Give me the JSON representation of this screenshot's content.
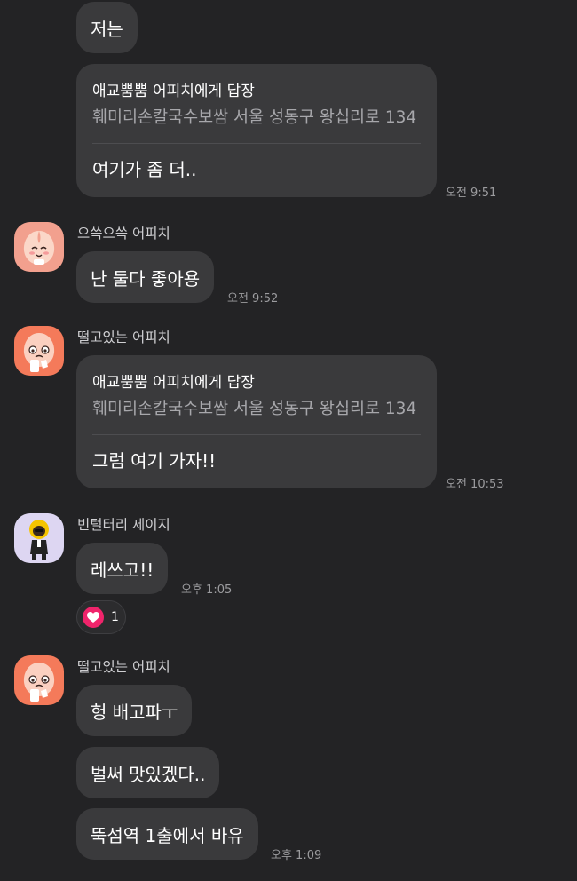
{
  "messages": {
    "m1": {
      "text": "저는"
    },
    "m2": {
      "reply_to": "애교뿜뿜 어피치에게 답장",
      "quote": "훼미리손칼국수보쌈 서울 성동구 왕십리로 134",
      "text": "여기가 좀 더..",
      "time": "오전 9:51"
    },
    "m3": {
      "sender": "으쓱으쓱 어피치",
      "text": "난 둘다 좋아용",
      "time": "오전 9:52"
    },
    "m4": {
      "sender": "떨고있는 어피치",
      "reply_to": "애교뿜뿜 어피치에게 답장",
      "quote": "훼미리손칼국수보쌈 서울 성동구 왕십리로 134",
      "text": "그럼 여기 가자!!",
      "time": "오전 10:53"
    },
    "m5": {
      "sender": "빈털터리 제이지",
      "text": "레쓰고!!",
      "time": "오후 1:05",
      "reaction_count": "1"
    },
    "m6": {
      "sender": "떨고있는 어피치",
      "lines": [
        "헝 배고파ㅜ",
        "벌써 맛있겠다..",
        "뚝섬역 1출에서 바유"
      ],
      "time": "오후 1:09"
    }
  },
  "icons": {
    "avatar_1": "apeach-avatar-icon",
    "avatar_2": "apeach-avatar-icon",
    "avatar_3": "jayg-avatar-icon",
    "avatar_4": "apeach-avatar-icon",
    "reaction": "heart-icon"
  },
  "colors": {
    "background": "#232325",
    "bubble": "#3a3a3c",
    "heart": "#f0246b",
    "apeach_pink": "#f2a08e",
    "apeach_orange": "#f47a5a",
    "jayg_bg": "#ddd6f2"
  }
}
